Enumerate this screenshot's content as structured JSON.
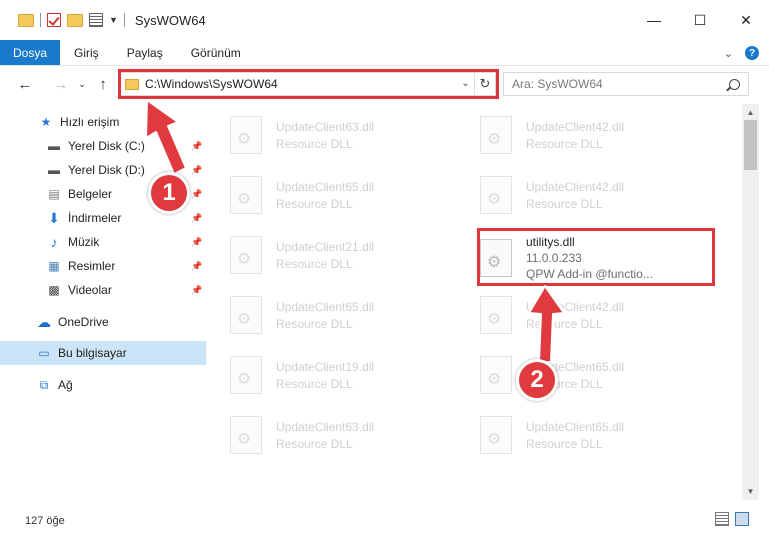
{
  "window": {
    "title": "SysWOW64",
    "minimize_icon": "minimize-icon",
    "maximize_icon": "maximize-icon",
    "close_icon": "close-icon"
  },
  "ribbon": {
    "tabs": [
      "Dosya",
      "Giriş",
      "Paylaş",
      "Görünüm"
    ],
    "help_label": "?"
  },
  "address": {
    "path": "C:\\Windows\\SysWOW64"
  },
  "search": {
    "placeholder": "Ara: SysWOW64"
  },
  "sidebar": {
    "quick_access": "Hızlı erişim",
    "items": [
      {
        "label": "Yerel Disk (C:)",
        "icon": "drive-icon"
      },
      {
        "label": "Yerel Disk (D:)",
        "icon": "drive-icon"
      },
      {
        "label": "Belgeler",
        "icon": "documents-icon"
      },
      {
        "label": "İndirmeler",
        "icon": "download-icon"
      },
      {
        "label": "Müzik",
        "icon": "music-icon"
      },
      {
        "label": "Resimler",
        "icon": "pictures-icon"
      },
      {
        "label": "Videolar",
        "icon": "videos-icon"
      }
    ],
    "onedrive": "OneDrive",
    "this_pc": "Bu bilgisayar",
    "network": "Ağ"
  },
  "files": {
    "left": [
      {
        "name": "UpdateClient63.dll",
        "type": "Resource DLL"
      },
      {
        "name": "UpdateClient65.dll",
        "type": "Resource DLL"
      },
      {
        "name": "UpdateClient21.dll",
        "type": "Resource DLL"
      },
      {
        "name": "UpdateClient65.dll",
        "type": "Resource DLL"
      },
      {
        "name": "UpdateClient19.dll",
        "type": "Resource DLL"
      },
      {
        "name": "UpdateClient63.dll",
        "type": "Resource DLL"
      }
    ],
    "right": [
      {
        "name": "UpdateClient42.dll",
        "type": "Resource DLL"
      },
      {
        "name": "UpdateClient42.dll",
        "type": "Resource DLL"
      },
      {
        "name": "UpdateClient42.dll",
        "type": "Resource DLL"
      },
      {
        "name": "UpdateClient65.dll",
        "type": "Resource DLL"
      },
      {
        "name": "UpdateClient65.dll",
        "type": "Resource DLL"
      }
    ],
    "highlighted": {
      "name": "utilitys.dll",
      "version": "11.0.0.233",
      "description": "QPW Add-in @functio..."
    }
  },
  "status": {
    "item_count": "127 öğe"
  },
  "annotations": {
    "step1": "1",
    "step2": "2",
    "color": "#d9363e"
  }
}
